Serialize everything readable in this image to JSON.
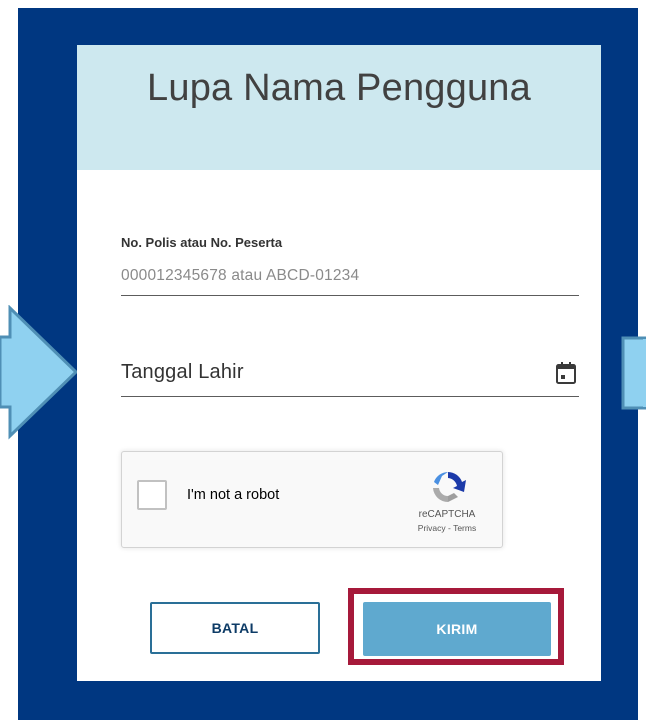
{
  "form": {
    "title": "Lupa Nama Pengguna",
    "policy_field": {
      "label": "No. Polis atau No. Peserta",
      "value": "",
      "placeholder": "000012345678 atau ABCD-01234"
    },
    "date_field": {
      "label": "Tanggal Lahir",
      "icon": "calendar-icon"
    },
    "recaptcha": {
      "checkbox_label": "I'm not a robot",
      "checked": false,
      "brand": "reCAPTCHA",
      "links": "Privacy - Terms",
      "icon": "recaptcha-logo-icon"
    },
    "buttons": {
      "cancel_label": "BATAL",
      "submit_label": "KIRIM"
    }
  },
  "colors": {
    "background_frame": "#003781",
    "header_band": "#cde8ef",
    "highlight_border": "#a6193a",
    "submit_button": "#5fa9cf",
    "arrow_fill": "#8fd1f0",
    "arrow_stroke": "#4f8fb5"
  }
}
